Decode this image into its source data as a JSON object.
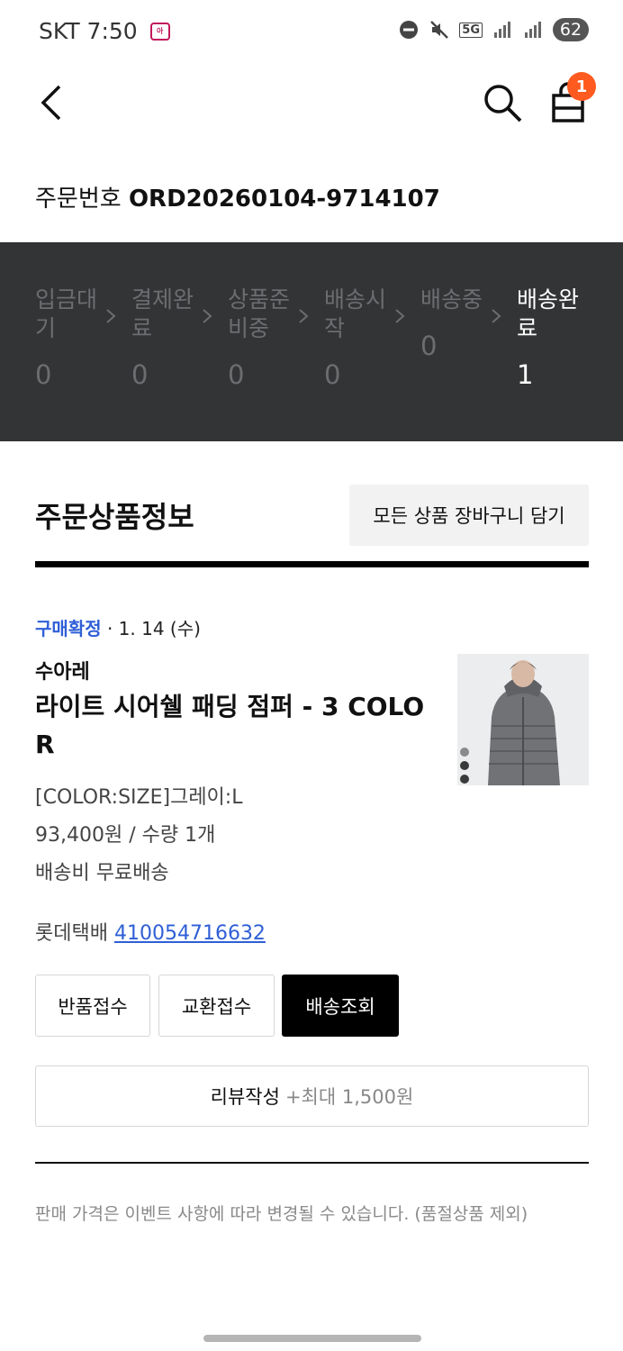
{
  "status_bar": {
    "carrier": "SKT",
    "time": "7:50",
    "network": "5G",
    "battery": "62"
  },
  "header": {
    "cart_badge": "1"
  },
  "order": {
    "label": "주문번호",
    "number": "ORD20260104-9714107"
  },
  "steps": [
    {
      "label": "입금대기",
      "count": "0",
      "active": false
    },
    {
      "label": "결제완료",
      "count": "0",
      "active": false
    },
    {
      "label": "상품준비중",
      "count": "0",
      "active": false
    },
    {
      "label": "배송시작",
      "count": "0",
      "active": false
    },
    {
      "label": "배송중",
      "count": "0",
      "active": false
    },
    {
      "label": "배송완료",
      "count": "1",
      "active": true
    }
  ],
  "section": {
    "title": "주문상품정보",
    "cart_all_label": "모든 상품 장바구니 담기"
  },
  "product": {
    "status": "구매확정",
    "date": "· 1. 14 (수)",
    "brand": "수아레",
    "name": "라이트 시어쉘 패딩 점퍼 - 3 COLOR",
    "option": "[COLOR:SIZE]그레이:L",
    "price_qty": "93,400원 / 수량 1개",
    "shipping": "배송비 무료배송",
    "courier": "롯데택배",
    "tracking_no": "410054716632"
  },
  "actions": {
    "return_label": "반품접수",
    "exchange_label": "교환접수",
    "tracking_label": "배송조회",
    "review_label": "리뷰작성",
    "review_reward": "+최대 1,500원"
  },
  "notice": "판매 가격은 이벤트 사항에 따라 변경될 수 있습니다. (품절상품 제외)",
  "colors": {
    "accent_blue": "#2f5fd6",
    "badge_orange": "#ff5a1f",
    "strip_bg": "#333436"
  }
}
